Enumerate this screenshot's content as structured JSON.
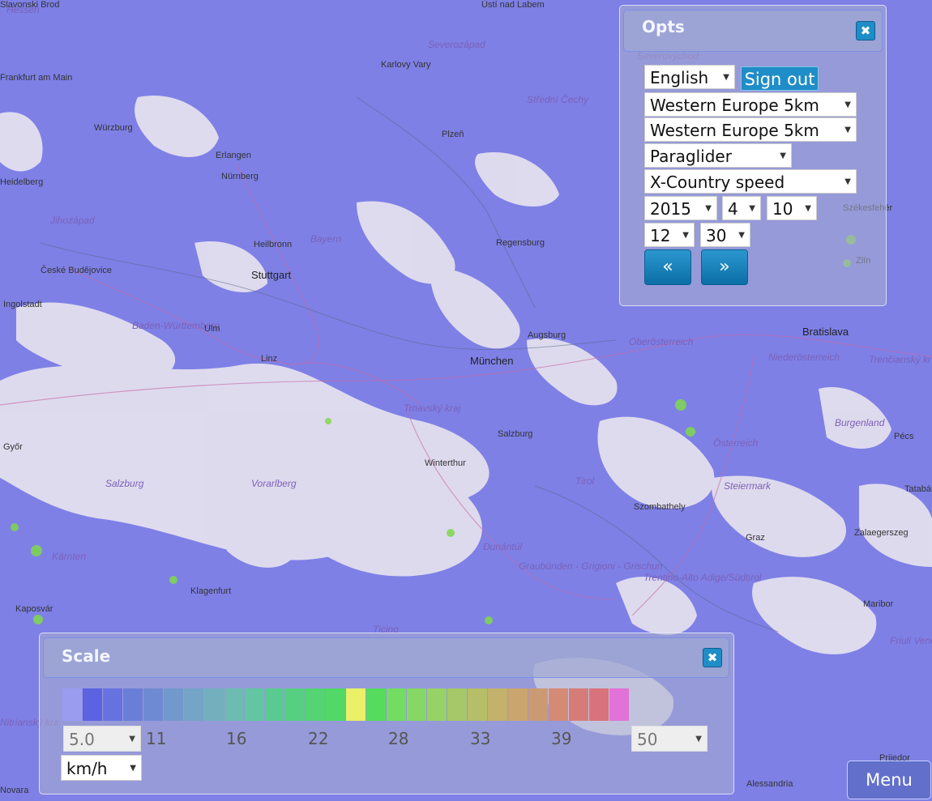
{
  "map": {
    "labels": [
      {
        "text": "Hessen",
        "kind": "region"
      },
      {
        "text": "Ústí nad Labem",
        "kind": "city"
      },
      {
        "text": "Severozápad",
        "kind": "region"
      },
      {
        "text": "Severovýchod",
        "kind": "region"
      },
      {
        "text": "Karlovy Vary",
        "kind": "city"
      },
      {
        "text": "Střední Čechy",
        "kind": "region"
      },
      {
        "text": "Frankfurt am Main",
        "kind": "city"
      },
      {
        "text": "Würzburg",
        "kind": "city"
      },
      {
        "text": "Plzeň",
        "kind": "city"
      },
      {
        "text": "Erlangen",
        "kind": "city"
      },
      {
        "text": "Nürnberg",
        "kind": "city"
      },
      {
        "text": "Heidelberg",
        "kind": "city"
      },
      {
        "text": "Jihozápad",
        "kind": "region"
      },
      {
        "text": "Heilbronn",
        "kind": "city"
      },
      {
        "text": "Bayern",
        "kind": "region"
      },
      {
        "text": "Regensburg",
        "kind": "city"
      },
      {
        "text": "České Budějovice",
        "kind": "city"
      },
      {
        "text": "Stuttgart",
        "kind": "big"
      },
      {
        "text": "Ingolstadt",
        "kind": "city"
      },
      {
        "text": "Baden-Württemberg",
        "kind": "region"
      },
      {
        "text": "Ulm",
        "kind": "city"
      },
      {
        "text": "Augsburg",
        "kind": "city"
      },
      {
        "text": "Linz",
        "kind": "city"
      },
      {
        "text": "München",
        "kind": "big"
      },
      {
        "text": "Oberösterreich",
        "kind": "region"
      },
      {
        "text": "Niederösterreich",
        "kind": "region"
      },
      {
        "text": "Bratislava",
        "kind": "big"
      },
      {
        "text": "Trnavský kraj",
        "kind": "region"
      },
      {
        "text": "Salzburg",
        "kind": "city"
      },
      {
        "text": "Österreich",
        "kind": "region"
      },
      {
        "text": "Burgenland",
        "kind": "region"
      },
      {
        "text": "Győr",
        "kind": "city"
      },
      {
        "text": "Winterthur",
        "kind": "city"
      },
      {
        "text": "Salzburg",
        "kind": "region"
      },
      {
        "text": "Vorarlberg",
        "kind": "region"
      },
      {
        "text": "Tirol",
        "kind": "region"
      },
      {
        "text": "Steiermark",
        "kind": "region"
      },
      {
        "text": "Szombathely",
        "kind": "city"
      },
      {
        "text": "Graz",
        "kind": "city"
      },
      {
        "text": "Zalaegerszeg",
        "kind": "city"
      },
      {
        "text": "Dunántúl",
        "kind": "region"
      },
      {
        "text": "Kärnten",
        "kind": "region"
      },
      {
        "text": "Graubünden - Grigioni - Grischun",
        "kind": "region"
      },
      {
        "text": "Klagenfurt",
        "kind": "city"
      },
      {
        "text": "Trentino-Alto Adige/Südtirol",
        "kind": "region"
      },
      {
        "text": "Maribor",
        "kind": "city"
      },
      {
        "text": "Kaposvár",
        "kind": "city"
      },
      {
        "text": "Ticino",
        "kind": "region"
      },
      {
        "text": "Friuli Venezia Giulia",
        "kind": "region"
      },
      {
        "text": "Pécs",
        "kind": "city"
      },
      {
        "text": "Tatabány",
        "kind": "city"
      },
      {
        "text": "Székesfehér",
        "kind": "city"
      },
      {
        "text": "Zlín",
        "kind": "city"
      },
      {
        "text": "Trenčianský kr",
        "kind": "region"
      },
      {
        "text": "Nitrianský kra",
        "kind": "region"
      },
      {
        "text": "Novara",
        "kind": "city"
      },
      {
        "text": "Alessandria",
        "kind": "city"
      },
      {
        "text": "Prijedor",
        "kind": "city"
      },
      {
        "text": "Slavonski Brod",
        "kind": "city"
      }
    ]
  },
  "opts": {
    "title": "Opts",
    "close_icon": "✖",
    "language": "English",
    "sign_out_label": "Sign out",
    "region1": "Western Europe 5km",
    "region2": "Western Europe 5km",
    "aircraft": "Paraglider",
    "parameter": "X-Country speed",
    "year": "2015",
    "month": "4",
    "day": "10",
    "hour": "12",
    "minute": "30",
    "prev_label": "«",
    "next_label": "»"
  },
  "scale": {
    "title": "Scale",
    "close_icon": "✖",
    "min_value": "5.0",
    "max_value": "50",
    "ticks": [
      "11",
      "16",
      "22",
      "28",
      "33",
      "39"
    ],
    "unit": "km/h",
    "colors": [
      "#9a9cf0",
      "#5c62e2",
      "#6672e0",
      "#6a7ed8",
      "#6e8ad2",
      "#7298cc",
      "#74a4c6",
      "#72b0be",
      "#6cbcb2",
      "#62c6a2",
      "#5acb90",
      "#56d080",
      "#54d472",
      "#52d866",
      "#eaf068",
      "#56dc5c",
      "#74dc62",
      "#86d864",
      "#96d266",
      "#a6c868",
      "#b6be6a",
      "#c2b26c",
      "#caa66e",
      "#cc9a72",
      "#d48a74",
      "#d67c78",
      "#d8727c",
      "#e072d8"
    ]
  },
  "menu_label": "Menu"
}
